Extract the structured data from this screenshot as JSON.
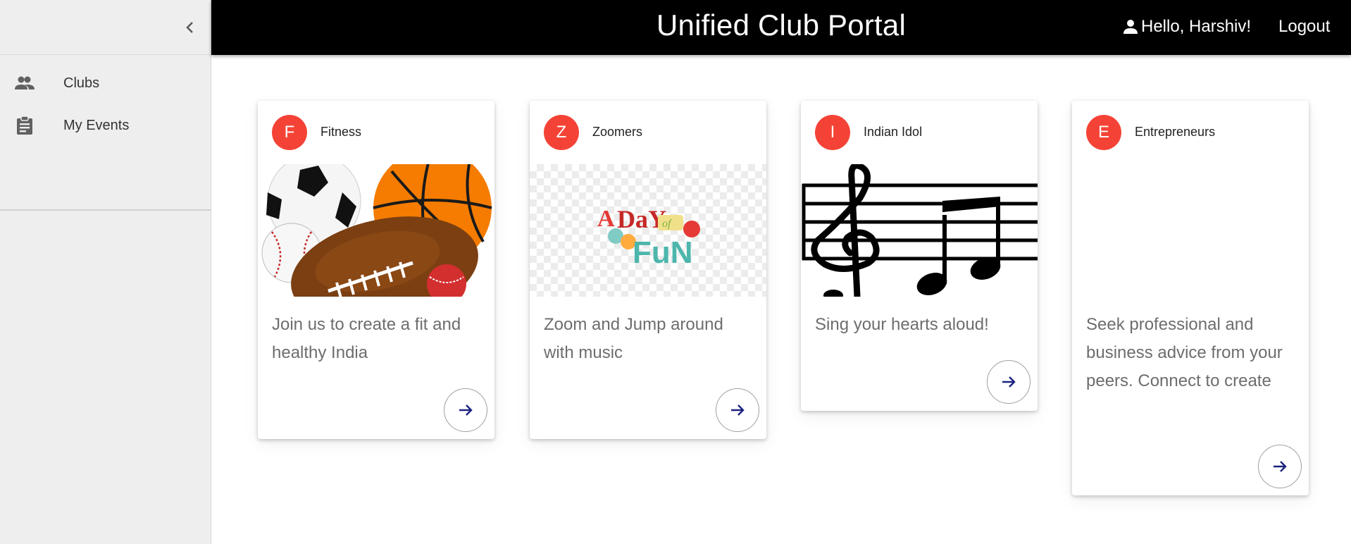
{
  "header": {
    "title": "Unified Club Portal",
    "greeting": "Hello, Harshiv!",
    "logout_label": "Logout"
  },
  "sidebar": {
    "items": [
      {
        "label": "Clubs",
        "icon": "people-icon"
      },
      {
        "label": "My Events",
        "icon": "clipboard-icon"
      }
    ]
  },
  "clubs": [
    {
      "initial": "F",
      "name": "Fitness",
      "description": "Join us to create a fit and healthy India",
      "image": "sports-balls-image"
    },
    {
      "initial": "Z",
      "name": "Zoomers",
      "description": "Zoom and Jump around with music",
      "image": "a-day-of-fun-image",
      "image_text": [
        "A",
        "DaY",
        "of",
        "FuN"
      ]
    },
    {
      "initial": "I",
      "name": "Indian Idol",
      "description": "Sing your hearts aloud!",
      "image": "music-notes-image"
    },
    {
      "initial": "E",
      "name": "Entrepreneurs",
      "description": "Seek professional and business advice from your peers. Connect to create",
      "image": ""
    }
  ],
  "colors": {
    "avatar": "#f44336",
    "topbar": "#000000",
    "sidebar": "#eeeeee",
    "arrow": "#1a237e"
  }
}
